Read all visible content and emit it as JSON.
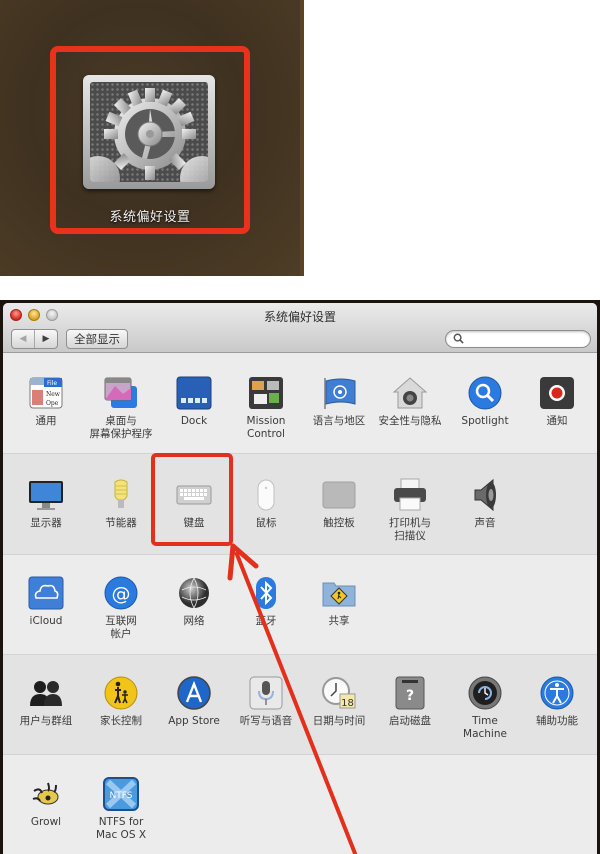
{
  "launcher": {
    "app_label": "系统偏好设置",
    "icon": "system-preferences-gear-icon",
    "highlight_color": "#e8321c"
  },
  "window": {
    "title": "系统偏好设置",
    "toolbar": {
      "back_glyph": "◀",
      "forward_glyph": "▶",
      "show_all_label": "全部显示",
      "search_placeholder": "",
      "search_value": ""
    },
    "rows": [
      {
        "panes": [
          {
            "id": "general",
            "label": "通用",
            "icon": "general-icon"
          },
          {
            "id": "desktop",
            "label": "桌面与\n屏幕保护程序",
            "icon": "desktop-screensaver-icon"
          },
          {
            "id": "dock",
            "label": "Dock",
            "icon": "dock-icon"
          },
          {
            "id": "mission-control",
            "label": "Mission\nControl",
            "icon": "mission-control-icon"
          },
          {
            "id": "language",
            "label": "语言与地区",
            "icon": "language-region-flag-icon"
          },
          {
            "id": "security",
            "label": "安全性与隐私",
            "icon": "security-privacy-house-icon"
          },
          {
            "id": "spotlight",
            "label": "Spotlight",
            "icon": "spotlight-magnifier-icon"
          },
          {
            "id": "notifications",
            "label": "通知",
            "icon": "notifications-icon"
          }
        ]
      },
      {
        "panes": [
          {
            "id": "displays",
            "label": "显示器",
            "icon": "display-monitor-icon"
          },
          {
            "id": "energy",
            "label": "节能器",
            "icon": "energy-saver-bulb-icon"
          },
          {
            "id": "keyboard",
            "label": "键盘",
            "icon": "keyboard-icon"
          },
          {
            "id": "mouse",
            "label": "鼠标",
            "icon": "mouse-icon"
          },
          {
            "id": "trackpad",
            "label": "触控板",
            "icon": "trackpad-icon"
          },
          {
            "id": "printers",
            "label": "打印机与\n扫描仪",
            "icon": "printer-icon"
          },
          {
            "id": "sound",
            "label": "声音",
            "icon": "speaker-icon"
          }
        ]
      },
      {
        "panes": [
          {
            "id": "icloud",
            "label": "iCloud",
            "icon": "icloud-icon"
          },
          {
            "id": "internet-accounts",
            "label": "互联网\n帐户",
            "icon": "at-sign-icon"
          },
          {
            "id": "network",
            "label": "网络",
            "icon": "network-globe-icon"
          },
          {
            "id": "bluetooth",
            "label": "蓝牙",
            "icon": "bluetooth-icon"
          },
          {
            "id": "sharing",
            "label": "共享",
            "icon": "sharing-folder-icon"
          }
        ]
      },
      {
        "panes": [
          {
            "id": "users",
            "label": "用户与群组",
            "icon": "users-groups-icon"
          },
          {
            "id": "parental",
            "label": "家长控制",
            "icon": "parental-controls-icon"
          },
          {
            "id": "appstore",
            "label": "App Store",
            "icon": "app-store-icon"
          },
          {
            "id": "dictation",
            "label": "听写与语音",
            "icon": "microphone-icon"
          },
          {
            "id": "datetime",
            "label": "日期与时间",
            "icon": "clock-calendar-icon",
            "badge": "18"
          },
          {
            "id": "startup",
            "label": "启动磁盘",
            "icon": "startup-disk-icon"
          },
          {
            "id": "timemachine",
            "label": "Time Machine",
            "icon": "time-machine-icon"
          },
          {
            "id": "accessibility",
            "label": "辅助功能",
            "icon": "accessibility-icon"
          }
        ]
      },
      {
        "panes": [
          {
            "id": "growl",
            "label": "Growl",
            "icon": "growl-paw-icon"
          },
          {
            "id": "ntfs",
            "label": "NTFS for\nMac OS X",
            "icon": "ntfs-icon",
            "icon_text": "NTFS"
          }
        ]
      }
    ]
  },
  "annotation": {
    "highlighted_pane": "keyboard",
    "color": "#e2301c"
  }
}
